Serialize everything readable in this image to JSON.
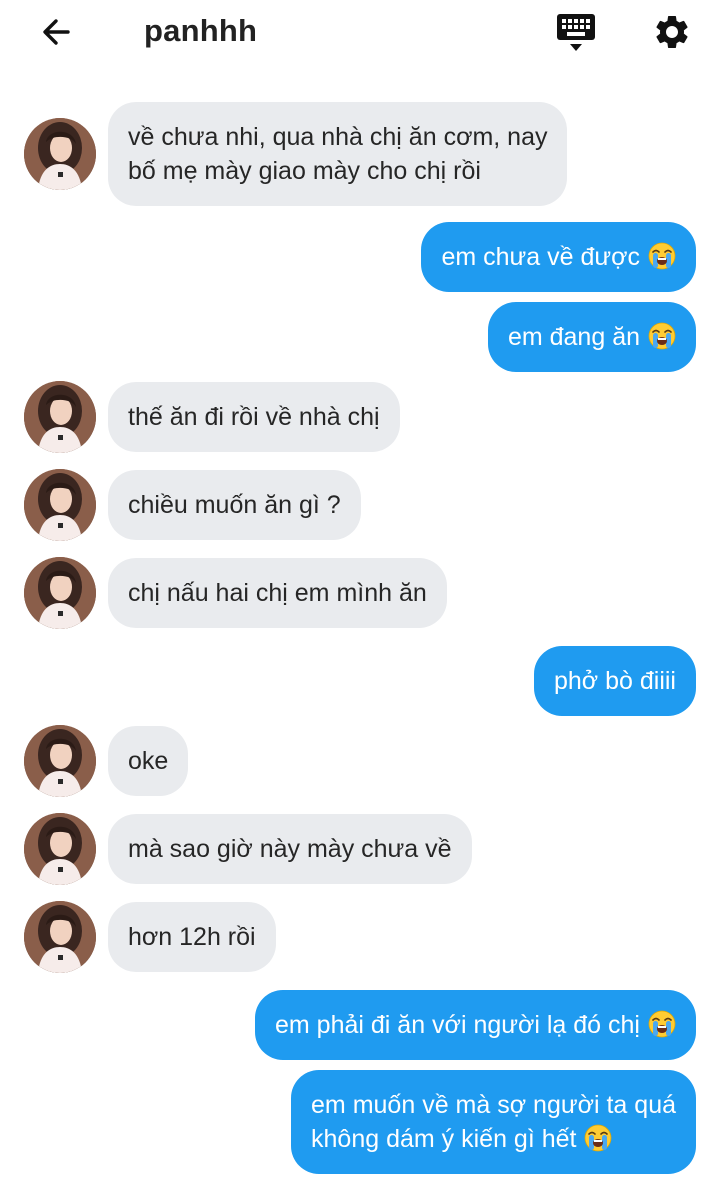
{
  "header": {
    "title": "panhhh",
    "back_icon": "arrow-left-icon",
    "keyboard_icon": "keyboard-icon",
    "settings_icon": "gear-icon"
  },
  "colors": {
    "outgoing_bubble": "#1f9bf0",
    "incoming_bubble": "#e9ebee"
  },
  "messages": [
    {
      "side": "in",
      "lines": [
        "về chưa nhi, qua nhà chị ăn cơm, nay",
        "bố mẹ mày giao mày cho chị rồi"
      ]
    },
    {
      "side": "out",
      "lines": [
        "em chưa về được"
      ],
      "emoji": "loudly-crying-face-icon"
    },
    {
      "side": "out",
      "lines": [
        "em đang ăn"
      ],
      "emoji": "loudly-crying-face-icon"
    },
    {
      "side": "in",
      "lines": [
        "thế ăn đi rồi về nhà chị"
      ]
    },
    {
      "side": "in",
      "lines": [
        "chiều muốn ăn gì ?"
      ]
    },
    {
      "side": "in",
      "lines": [
        "chị nấu hai chị em mình ăn"
      ]
    },
    {
      "side": "out",
      "lines": [
        "phở bò điiii"
      ]
    },
    {
      "side": "in",
      "lines": [
        "oke"
      ]
    },
    {
      "side": "in",
      "lines": [
        "mà sao giờ này mày chưa về"
      ]
    },
    {
      "side": "in",
      "lines": [
        "hơn 12h rồi"
      ]
    },
    {
      "side": "out",
      "lines": [
        "em phải đi ăn với người lạ đó chị"
      ],
      "emoji": "loudly-crying-face-icon"
    },
    {
      "side": "out",
      "lines": [
        "em muốn về mà sợ người ta quá",
        "không dám ý kiến gì hết"
      ],
      "emoji": "loudly-crying-face-icon"
    }
  ]
}
